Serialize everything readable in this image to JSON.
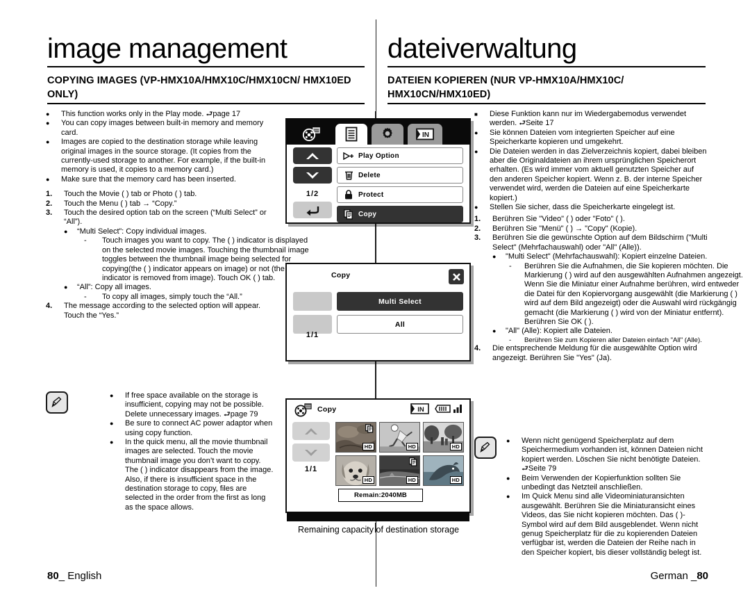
{
  "english": {
    "title": "image management",
    "subtitle": "COPYING IMAGES (VP-HMX10A/HMX10C/HMX10CN/ HMX10ED ONLY)",
    "bullets": [
      "This function works only in the Play mode. ⮐page 17",
      "You can copy images between built-in memory and memory card.",
      "Images are copied to the destination storage while leaving original images in the source storage. (It copies from the currently-used storage to another. For example, if the built-in memory is used, it copies to a memory card.)",
      "Make sure that the memory card has been inserted."
    ],
    "steps": [
      {
        "num": "1.",
        "text": "Touch the Movie (    ) tab or Photo (    ) tab."
      },
      {
        "num": "2.",
        "text": "Touch the Menu (    ) tab → “Copy.”"
      },
      {
        "num": "3.",
        "text": "Touch the desired option tab on the screen (“Multi Select” or “All”)."
      },
      {
        "num": "4.",
        "text": "The message according to the selected option will appear. Touch the “Yes.”"
      }
    ],
    "sub_multi": "“Multi Select”: Copy individual images.",
    "sub_multi_detail": "Touch images you want to copy. The (    ) indicator is displayed on the selected movie images. Touching the thumbnail image toggles between the thumbnail image being selected for copying(the (    ) indicator appears on image) or not (the (    ) indicator is removed from image). Touch OK (       ) tab.",
    "sub_all": "“All”: Copy all images.",
    "sub_all_detail": "To copy all images, simply touch the “All.”",
    "notes": [
      "If free space available on the storage is insufficient, copying may not be possible. Delete unnecessary images. ⮐page 79",
      "Be sure to connect AC power adaptor when using copy function.",
      "In the quick menu, all the movie thumbnail images are selected. Touch the movie thumbnail image you don’t want to copy. The (    ) indicator disappears from the image. Also, if there is insufficient space in the destination storage to copy, files are selected in the order from the first as long as the space allows."
    ],
    "footer": {
      "page": "80",
      "lang": "English"
    }
  },
  "german": {
    "title": "dateiverwaltung",
    "subtitle": "DATEIEN KOPIEREN (NUR VP-HMX10A/HMX10C/ HMX10CN/HMX10ED)",
    "bullets": [
      "Diese Funktion kann nur im Wiedergabemodus verwendet werden. ⮐Seite 17",
      "Sie können Dateien vom integrierten Speicher auf eine Speicherkarte kopieren und umgekehrt.",
      "Die Dateien werden in das Zielverzeichnis kopiert, dabei bleiben aber die Originaldateien an ihrem ursprünglichen Speicherort erhalten. (Es wird immer vom aktuell genutzten Speicher auf den anderen Speicher kopiert. Wenn z. B. der interne Speicher verwendet wird, werden die Dateien auf eine Speicherkarte kopiert.)",
      "Stellen Sie sicher, dass die Speicherkarte eingelegt ist."
    ],
    "steps": [
      {
        "num": "1.",
        "text": "Berühren Sie \"Video\" (    ) oder \"Foto\" (    )."
      },
      {
        "num": "2.",
        "text": "Berühren Sie \"Menü\" (    ) → \"Copy\" (Kopie)."
      },
      {
        "num": "3.",
        "text": "Berühren Sie die gewünschte Option auf dem Bildschirm (\"Multi Select\" (Mehrfachauswahl) oder \"All\" (Alle))."
      },
      {
        "num": "4.",
        "text": "Die entsprechende Meldung für die ausgewählte Option wird angezeigt. Berühren Sie \"Yes\" (Ja)."
      }
    ],
    "sub_multi": "\"Multi Select\" (Mehrfachauswahl): Kopiert einzelne Dateien.",
    "sub_multi_detail": "Berühren Sie die Aufnahmen, die Sie kopieren möchten. Die Markierung (    ) wird auf den ausgewählten Aufnahmen angezeigt. Wenn Sie die Miniatur einer Aufnahme berühren, wird entweder die Datei für den Kopiervorgang ausgewählt (die Markierung (    ) wird auf dem Bild angezeigt) oder die Auswahl wird rückgängig gemacht (die Markierung (   ) wird von der Miniatur entfernt). Berühren Sie OK (      ).",
    "sub_all": "\"All\" (Alle): Kopiert alle Dateien.",
    "sub_all_detail": "Berühren Sie zum Kopieren aller Dateien einfach \"All\" (Alle).",
    "notes": [
      "Wenn nicht genügend Speicherplatz auf dem Speichermedium vorhanden ist, können Dateien nicht kopiert werden. Löschen Sie nicht benötigte Dateien. ⮐Seite 79",
      "Beim Verwenden der Kopierfunktion sollten Sie unbedingt das Netzteil anschließen.",
      "Im Quick Menu sind alle Videominiaturansichten ausgewählt. Berühren Sie die Miniaturansicht eines Videos, das Sie nicht kopieren möchten. Das (   )-Symbol wird auf dem Bild ausgeblendet. Wenn nicht genug Speicherplatz für die zu kopierenden Dateien verfügbar ist, werden die Dateien der Reihe nach in den Speicher kopiert, bis dieser vollständig belegt ist."
    ],
    "footer": {
      "page": "80",
      "lang": "German"
    }
  },
  "screens": {
    "caption": "Remaining capacity of destination storage",
    "menu_screen": {
      "tabs": [
        {
          "name": "movie-tab",
          "icon": "film-reel-icon",
          "state": "inactive-dark"
        },
        {
          "name": "menu-tab",
          "icon": "list-icon",
          "state": "selected"
        },
        {
          "name": "settings-tab",
          "icon": "gear-icon",
          "state": "unselected"
        },
        {
          "name": "storage-tab",
          "icon": "in-memory-icon",
          "state": "unselected"
        }
      ],
      "up_label": "▲",
      "down_label": "▼",
      "page": "1/2",
      "back_label": "↩",
      "items": [
        {
          "label": "Play Option",
          "icon": "play-option-icon",
          "selected": false
        },
        {
          "label": "Delete",
          "icon": "trash-icon",
          "selected": false
        },
        {
          "label": "Protect",
          "icon": "lock-icon",
          "selected": false
        },
        {
          "label": "Copy",
          "icon": "copy-icon",
          "selected": true
        }
      ]
    },
    "copy_screen": {
      "title": "Copy",
      "close_label": "✕",
      "page": "1/1",
      "options": [
        {
          "label": "Multi Select",
          "selected": true
        },
        {
          "label": "All",
          "selected": false
        }
      ]
    },
    "thumb_screen": {
      "title": "Copy",
      "storage_badge": "IN",
      "battery_icon": "battery-icon",
      "signal_icon": "signal-icon",
      "page": "1/1",
      "up_label": "▲",
      "down_label": "▼",
      "quality_badge": "HD",
      "remaining": "Remain:2040MB",
      "thumbnails": [
        {
          "alt": "rock-texture-thumbnail",
          "marked": true
        },
        {
          "alt": "soccer-player-thumbnail",
          "marked": false
        },
        {
          "alt": "park-trees-thumbnail",
          "marked": false
        },
        {
          "alt": "dog-portrait-thumbnail",
          "marked": false
        },
        {
          "alt": "beach-shore-thumbnail",
          "marked": true
        },
        {
          "alt": "dolphin-thumbnail",
          "marked": false
        }
      ]
    }
  }
}
